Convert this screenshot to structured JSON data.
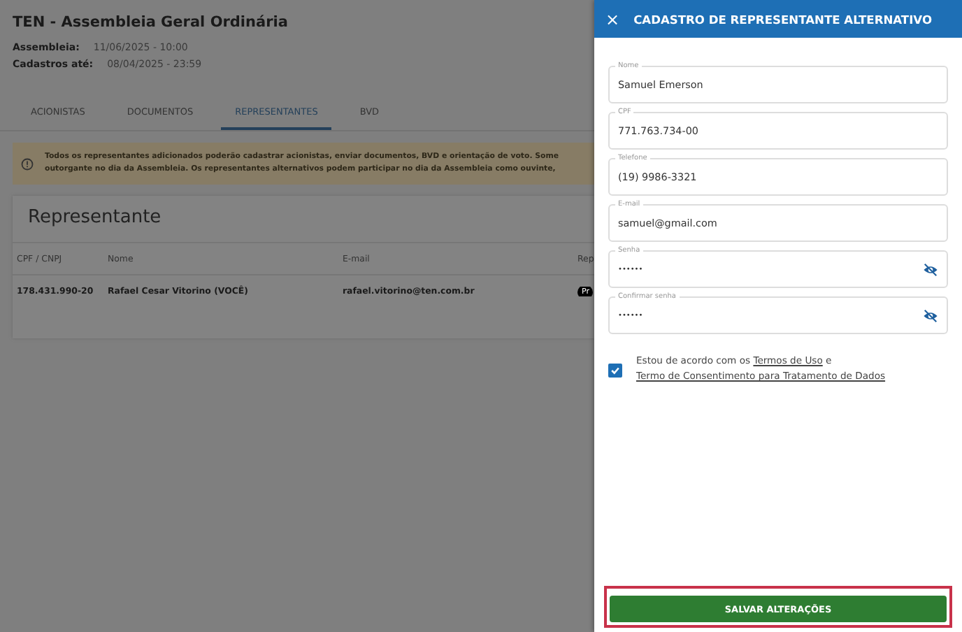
{
  "page": {
    "title": "TEN - Assembleia Geral Ordinária",
    "meta": [
      {
        "label": "Assembleia:",
        "value": "11/06/2025 - 10:00"
      },
      {
        "label": "Cadastros até:",
        "value": "08/04/2025 - 23:59"
      }
    ],
    "tabs": [
      {
        "label": "ACIONISTAS",
        "selected": false
      },
      {
        "label": "DOCUMENTOS",
        "selected": false
      },
      {
        "label": "REPRESENTANTES",
        "selected": true
      },
      {
        "label": "BVD",
        "selected": false
      }
    ],
    "notice": [
      "Todos os representantes adicionados poderão cadastrar acionistas, enviar documentos, BVD e orientação de voto. Some",
      "outorgante no dia da Assembleia. Os representantes alternativos podem participar no dia da Assembleia como ouvinte,"
    ],
    "card": {
      "title": "Representante",
      "columns": [
        "CPF / CNPJ",
        "Nome",
        "E-mail",
        "Rep"
      ],
      "rows": [
        {
          "cpf": "178.431.990-20",
          "name": "Rafael Cesar Vitorino (VOCÊ)",
          "email": "rafael.vitorino@ten.com.br",
          "badge": "Pr"
        }
      ]
    }
  },
  "drawer": {
    "close": "×",
    "title": "CADASTRO DE REPRESENTANTE ALTERNATIVO",
    "fields": [
      {
        "label": "Nome",
        "value": "Samuel Emerson",
        "kind": "text"
      },
      {
        "label": "CPF",
        "value": "771.763.734-00",
        "kind": "text"
      },
      {
        "label": "Telefone",
        "value": "(19) 9986-3321",
        "kind": "text"
      },
      {
        "label": "E-mail",
        "value": "samuel@gmail.com",
        "kind": "text"
      },
      {
        "label": "Senha",
        "value": "••••••",
        "kind": "password"
      },
      {
        "label": "Confirmar senha",
        "value": "••••••",
        "kind": "password"
      }
    ],
    "consent": {
      "checked": true,
      "parts": [
        {
          "text": "Estou de acordo com os",
          "kind": "text"
        },
        {
          "text": "Termos de Uso",
          "kind": "link"
        },
        {
          "text": "e",
          "kind": "text"
        },
        {
          "text": "Termo de Consentimento para Tratamento de Dados",
          "kind": "link"
        }
      ]
    },
    "save_button": "SALVAR ALTERAÇÕES"
  }
}
